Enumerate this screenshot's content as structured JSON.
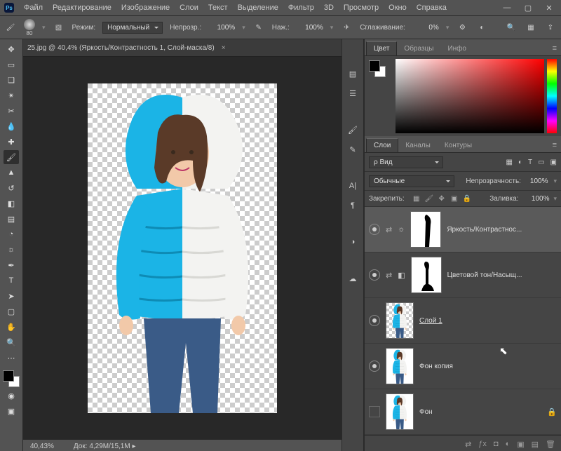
{
  "menu": {
    "items": [
      "Файл",
      "Редактирование",
      "Изображение",
      "Слои",
      "Текст",
      "Выделение",
      "Фильтр",
      "3D",
      "Просмотр",
      "Окно",
      "Справка"
    ]
  },
  "optbar": {
    "brush_size": "80",
    "mode_label": "Режим:",
    "mode_value": "Нормальный",
    "opacity_label": "Непрозр.:",
    "opacity_value": "100%",
    "flow_label": "Наж.:",
    "flow_value": "100%",
    "smoothing_label": "Сглаживание:",
    "smoothing_value": "0%"
  },
  "doc_tab": "25.jpg @ 40,4% (Яркость/Контрастность 1, Слой-маска/8)",
  "status": {
    "zoom": "40,43%",
    "doc_label": "Док:",
    "doc_value": "4,29M/15,1M"
  },
  "panels": {
    "color_tabs": [
      "Цвет",
      "Образцы",
      "Инфо"
    ],
    "layers_tabs": [
      "Слои",
      "Каналы",
      "Контуры"
    ],
    "filter_label": "ρ Вид",
    "blend_mode": "Обычные",
    "opacity_label": "Непрозрачность:",
    "opacity_value": "100%",
    "lock_label": "Закрепить:",
    "fill_label": "Заливка:",
    "fill_value": "100%",
    "layers": [
      {
        "name": "Яркость/Контрастнос...",
        "adj": true,
        "selected": true
      },
      {
        "name": "Цветовой тон/Насыщ...",
        "adj": true
      },
      {
        "name": "Слой 1",
        "thumb": "trans",
        "underline": true
      },
      {
        "name": "Фон копия",
        "thumb": "img"
      },
      {
        "name": "Фон",
        "thumb": "img",
        "locked": true,
        "novis": true
      }
    ]
  }
}
